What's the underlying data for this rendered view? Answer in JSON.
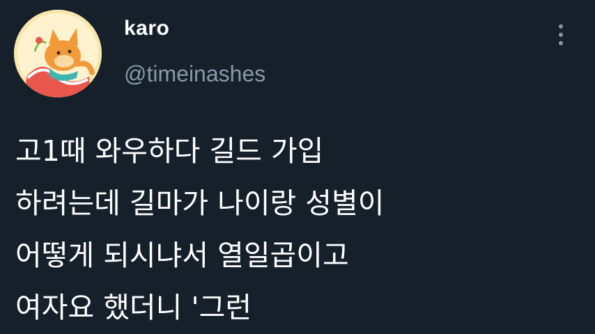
{
  "author": {
    "display_name": "karo",
    "handle": "@timeinashes",
    "avatar_icon": "cartoon-fox-avatar"
  },
  "menu_icon": "more-options-icon",
  "tweet_text_lines": [
    "고1때 와우하다 길드 가입",
    "하려는데 길마가 나이랑 성별이",
    "어떻게 되시냐서 열일곱이고",
    "여자요 했더니 '그런"
  ],
  "colors": {
    "background": "#15202b",
    "text": "#ffffff",
    "secondary_text": "#8899a6"
  }
}
